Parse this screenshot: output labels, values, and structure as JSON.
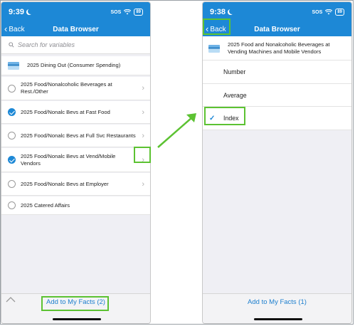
{
  "left_phone": {
    "status": {
      "time": "9:39",
      "carrier": "SOS",
      "battery": "89"
    },
    "nav": {
      "back_label": "Back",
      "title": "Data Browser"
    },
    "search": {
      "placeholder": "Search for variables",
      "icon": "search-icon"
    },
    "header_item": {
      "label": "2025 Dining Out (Consumer Spending)",
      "icon": "card-icon"
    },
    "items": [
      {
        "label": "2025 Food/Nonalcoholic Beverages at Rest./Other",
        "checked": false
      },
      {
        "label": "2025 Food/Nonalc Bevs at Fast Food",
        "checked": true
      },
      {
        "label": "2025 Food/Nonalc Bevs at Full Svc Restaurants",
        "checked": false
      },
      {
        "label": "2025 Food/Nonalc Bevs at Vend/Mobile Vendors",
        "checked": true
      },
      {
        "label": "2025 Food/Nonalc Bevs at Employer",
        "checked": false
      },
      {
        "label": "2025 Catered Affairs",
        "checked": false
      }
    ],
    "bottom_action": "Add to My Facts (2)"
  },
  "right_phone": {
    "status": {
      "time": "9:38",
      "carrier": "SOS",
      "battery": "89"
    },
    "nav": {
      "back_label": "Back",
      "title": "Data Browser"
    },
    "header_item": {
      "label": "2025 Food and Nonalcoholic Beverages at Vending Machines and Mobile Vendors",
      "icon": "card-icon"
    },
    "options": [
      {
        "label": "Number",
        "checked": false
      },
      {
        "label": "Average",
        "checked": false
      },
      {
        "label": "Index",
        "checked": true
      }
    ],
    "bottom_action": "Add to My Facts (1)"
  },
  "colors": {
    "accent": "#1d88d6",
    "highlight": "#5cc232",
    "link": "#1d7fce"
  }
}
